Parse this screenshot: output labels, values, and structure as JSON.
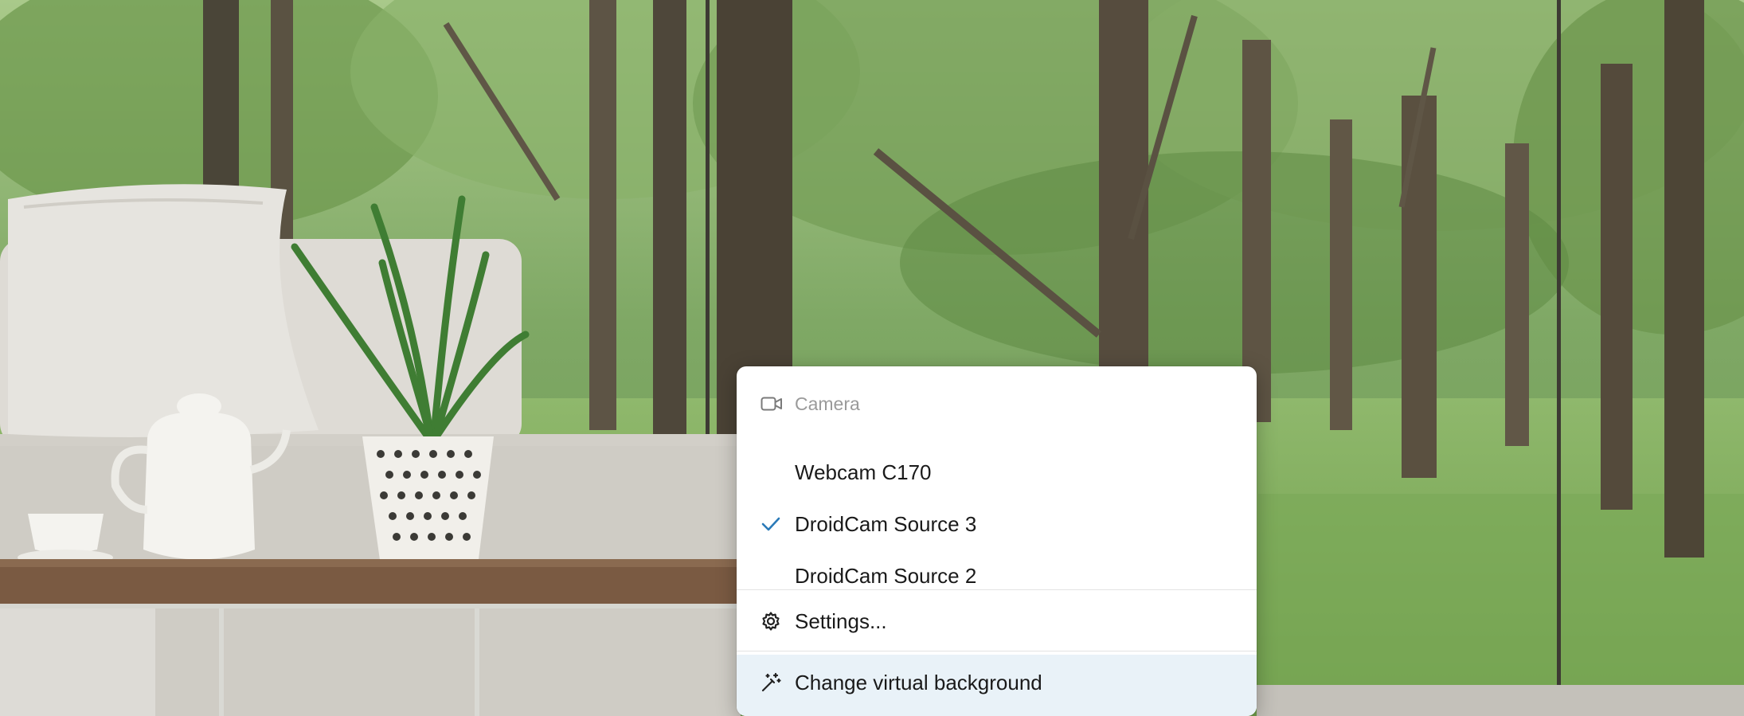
{
  "menu": {
    "header": {
      "label": "Camera",
      "icon": "video-camera-icon"
    },
    "cameras": [
      {
        "label": "Webcam C170",
        "selected": false
      },
      {
        "label": "DroidCam Source 3",
        "selected": true,
        "icon": "checkmark-icon"
      },
      {
        "label": "DroidCam Source 2",
        "selected": false
      }
    ],
    "settings": {
      "label": "Settings...",
      "icon": "gear-icon"
    },
    "virtual_background": {
      "label": "Change virtual background",
      "icon": "magic-wand-icon",
      "highlighted": true
    }
  },
  "colors": {
    "accent": "#2a7ab8",
    "highlight": "#e9f2f8",
    "header_text": "#9a9a9a"
  }
}
